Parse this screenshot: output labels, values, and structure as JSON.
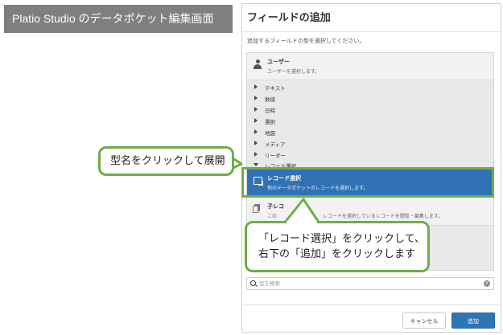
{
  "banner": {
    "title": "Platio Studio のデータポケット編集画面"
  },
  "dialog": {
    "title": "フィールドの追加",
    "instruction": "追加するフィールドの型を選択してください。",
    "user_item": {
      "name": "ユーザー",
      "description": "ユーザーを選択します。",
      "icon": "user-icon"
    },
    "categories": [
      {
        "label": "テキスト",
        "expanded": false
      },
      {
        "label": "数値",
        "expanded": false
      },
      {
        "label": "日時",
        "expanded": false
      },
      {
        "label": "選択",
        "expanded": false
      },
      {
        "label": "地図",
        "expanded": false
      },
      {
        "label": "メディア",
        "expanded": false
      },
      {
        "label": "リーダー",
        "expanded": false
      },
      {
        "label": "レコード選択",
        "expanded": true
      }
    ],
    "selected_item": {
      "name": "レコード選択",
      "description": "他のデータポケットのレコードを選択します。",
      "icon": "record-icon"
    },
    "child_item": {
      "name": "子レコ",
      "description": "この",
      "description_tail": "レコードを選択しているレコードを閲覧・編集します。",
      "icon": "document-icon"
    },
    "search": {
      "placeholder": "型を検索",
      "value": ""
    },
    "buttons": {
      "cancel": "キャンセル",
      "add": "追加"
    }
  },
  "callouts": {
    "expand": "型名をクリックして展開",
    "select_line1": "「レコード選択」をクリックして、",
    "select_line2": "右下の「追加」をクリックします"
  },
  "colors": {
    "accent_green": "#70ad47",
    "selection_blue": "#3172b4",
    "banner_gray": "#7f7f7f"
  }
}
